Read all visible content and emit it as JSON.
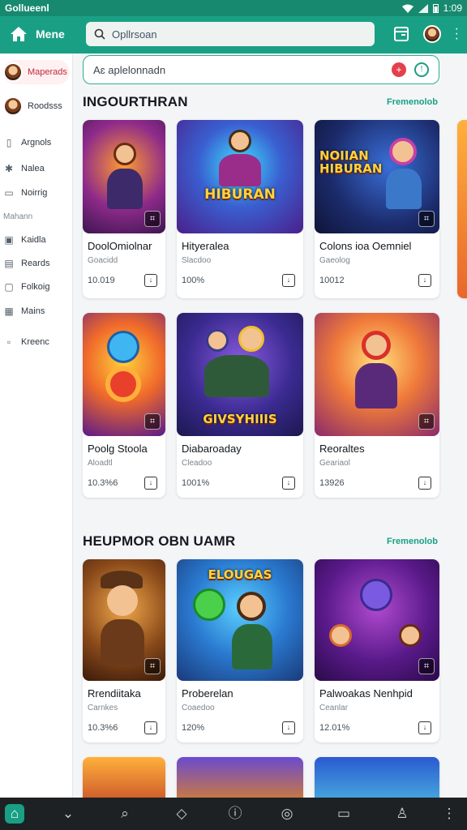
{
  "status": {
    "app_name": "Gollueenl",
    "time": "1:09"
  },
  "header": {
    "menu_label": "Mene",
    "search_placeholder": "Opllrsoan"
  },
  "sidebar": {
    "items": [
      {
        "label": "Maperads",
        "active": true
      },
      {
        "label": "Roodsss"
      },
      {
        "label": "Argnols"
      },
      {
        "label": "Nalea"
      },
      {
        "label": "Noirrig"
      },
      {
        "label": "Kaidla"
      },
      {
        "label": "Reards"
      },
      {
        "label": "Folkoig"
      },
      {
        "label": "Mains"
      },
      {
        "label": "Kreenc"
      }
    ],
    "heading": "Mahann"
  },
  "filter": {
    "text": "Aɛ  aplelonnadn"
  },
  "sections": [
    {
      "title": "INGOURTHRAN",
      "link": "Fremenolob",
      "cards": [
        {
          "title": "DoolOmiolnar",
          "sub": "Goacidd",
          "meta": "10.019",
          "banner": ""
        },
        {
          "title": "Hityeralea",
          "sub": "Slacdoo",
          "meta": "100%",
          "banner": "HIBURAN"
        },
        {
          "title": "Colons ioa Oemniel",
          "sub": "Gaeolog",
          "meta": "10012",
          "banner": "NOIIAN HIBURAN"
        },
        {
          "title": "Poolg Stoola",
          "sub": "Aloadtl",
          "meta": "10.3%6",
          "banner": ""
        },
        {
          "title": "Diabaroaday",
          "sub": "Cleadoo",
          "meta": "1001%",
          "banner": "GIVSYHIIIS"
        },
        {
          "title": "Reoraltes",
          "sub": "Geariaol",
          "meta": "13926",
          "banner": ""
        }
      ]
    },
    {
      "title": "HEUPMOR OBN UAMR",
      "link": "Fremenolob",
      "cards": [
        {
          "title": "Rrendiitaka",
          "sub": "Carnkes",
          "meta": "10.3%6",
          "banner": ""
        },
        {
          "title": "Proberelan",
          "sub": "Coaedoo",
          "meta": "120%",
          "banner": "ELOUGAS"
        },
        {
          "title": "Palwoakas Nenhpid",
          "sub": "Ceanlar",
          "meta": "12.01%",
          "banner": ""
        }
      ]
    }
  ],
  "colors": {
    "accent": "#19a084",
    "brand_dark": "#17896f",
    "alert": "#e4404b"
  }
}
